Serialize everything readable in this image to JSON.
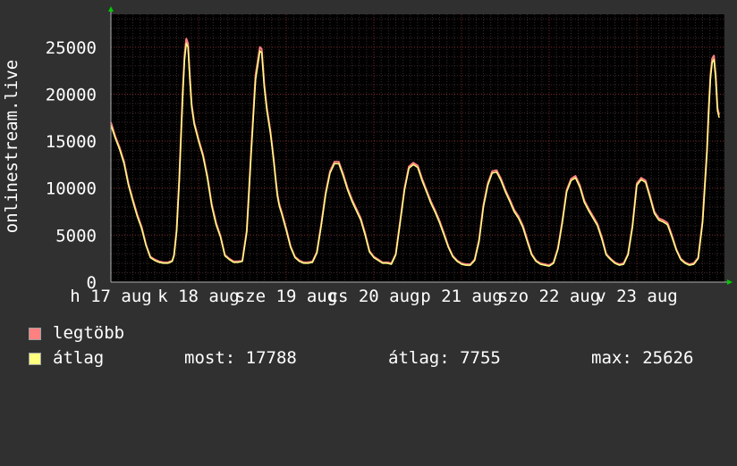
{
  "chart_data": {
    "type": "line",
    "ylabel": "onlinestream.live",
    "yticks": [
      0,
      5000,
      10000,
      15000,
      20000,
      25000
    ],
    "ylim": [
      0,
      28500
    ],
    "xlim": [
      0,
      7.0
    ],
    "grid": true,
    "xtick_labels": [
      {
        "pos": 0.0,
        "label": "h 17 aug"
      },
      {
        "pos": 1.0,
        "label": "k 18 aug"
      },
      {
        "pos": 2.0,
        "label": "sze 19 aug"
      },
      {
        "pos": 3.0,
        "label": "cs 20 aug"
      },
      {
        "pos": 4.0,
        "label": "p 21 aug"
      },
      {
        "pos": 5.0,
        "label": "szo 22 aug"
      },
      {
        "pos": 6.0,
        "label": "v 23 aug"
      }
    ],
    "series": [
      {
        "name": "legtöbb",
        "color": "#ff8080",
        "x": [
          0.0,
          0.05,
          0.1,
          0.15,
          0.2,
          0.25,
          0.3,
          0.35,
          0.4,
          0.45,
          0.5,
          0.55,
          0.6,
          0.65,
          0.7,
          0.72,
          0.75,
          0.78,
          0.8,
          0.82,
          0.84,
          0.86,
          0.88,
          0.9,
          0.92,
          0.95,
          1.0,
          1.05,
          1.1,
          1.15,
          1.2,
          1.25,
          1.3,
          1.35,
          1.4,
          1.45,
          1.5,
          1.55,
          1.6,
          1.65,
          1.7,
          1.72,
          1.75,
          1.78,
          1.8,
          1.82,
          1.84,
          1.86,
          1.88,
          1.9,
          1.92,
          1.95,
          2.0,
          2.05,
          2.1,
          2.15,
          2.2,
          2.25,
          2.3,
          2.35,
          2.4,
          2.45,
          2.5,
          2.55,
          2.6,
          2.65,
          2.7,
          2.75,
          2.8,
          2.85,
          2.9,
          2.95,
          3.0,
          3.05,
          3.1,
          3.15,
          3.2,
          3.25,
          3.3,
          3.35,
          3.4,
          3.45,
          3.5,
          3.55,
          3.6,
          3.65,
          3.7,
          3.75,
          3.8,
          3.85,
          3.9,
          3.95,
          4.0,
          4.05,
          4.1,
          4.15,
          4.2,
          4.25,
          4.3,
          4.35,
          4.4,
          4.45,
          4.5,
          4.55,
          4.6,
          4.65,
          4.7,
          4.75,
          4.8,
          4.85,
          4.9,
          4.95,
          5.0,
          5.05,
          5.1,
          5.15,
          5.2,
          5.25,
          5.3,
          5.35,
          5.4,
          5.45,
          5.5,
          5.55,
          5.6,
          5.65,
          5.7,
          5.75,
          5.8,
          5.85,
          5.9,
          5.95,
          6.0,
          6.05,
          6.1,
          6.15,
          6.2,
          6.25,
          6.3,
          6.35,
          6.4,
          6.45,
          6.5,
          6.55,
          6.6,
          6.65,
          6.7,
          6.75,
          6.8,
          6.82,
          6.84,
          6.86,
          6.88,
          6.9,
          6.92,
          6.94
        ],
        "values": [
          17000,
          15500,
          14300,
          12800,
          10500,
          8800,
          7200,
          5900,
          4000,
          2700,
          2400,
          2200,
          2100,
          2100,
          2300,
          2900,
          5600,
          11000,
          15800,
          20500,
          24100,
          25900,
          25400,
          22000,
          19000,
          17000,
          15200,
          13600,
          11300,
          8300,
          6300,
          4900,
          2900,
          2500,
          2200,
          2200,
          2300,
          5500,
          14000,
          22000,
          25000,
          24800,
          21000,
          18500,
          17300,
          16000,
          14500,
          12800,
          11000,
          9300,
          8300,
          7400,
          5700,
          3800,
          2700,
          2300,
          2100,
          2100,
          2200,
          3200,
          6200,
          9500,
          11800,
          12800,
          12800,
          11500,
          10000,
          8800,
          7800,
          6800,
          5200,
          3300,
          2700,
          2400,
          2100,
          2100,
          2000,
          3000,
          6500,
          10000,
          12300,
          12700,
          12400,
          11000,
          9800,
          8600,
          7600,
          6500,
          5200,
          3800,
          2800,
          2300,
          2000,
          1900,
          1900,
          2400,
          4500,
          8200,
          10500,
          11800,
          11900,
          11000,
          9800,
          8800,
          7700,
          7000,
          6000,
          4500,
          3000,
          2300,
          2000,
          1900,
          1800,
          2100,
          3600,
          6500,
          9800,
          11000,
          11300,
          10300,
          8700,
          7800,
          7000,
          6200,
          4800,
          3000,
          2500,
          2100,
          1900,
          2000,
          3000,
          6000,
          10500,
          11100,
          10800,
          9200,
          7500,
          6800,
          6600,
          6300,
          5000,
          3500,
          2500,
          2100,
          1900,
          2000,
          2600,
          6500,
          14000,
          18500,
          22000,
          23800,
          24100,
          22000,
          18500,
          17800
        ]
      },
      {
        "name": "átlag",
        "color": "#ffff80",
        "x": [
          0.0,
          0.05,
          0.1,
          0.15,
          0.2,
          0.25,
          0.3,
          0.35,
          0.4,
          0.45,
          0.5,
          0.55,
          0.6,
          0.65,
          0.7,
          0.72,
          0.75,
          0.78,
          0.8,
          0.82,
          0.84,
          0.86,
          0.88,
          0.9,
          0.92,
          0.95,
          1.0,
          1.05,
          1.1,
          1.15,
          1.2,
          1.25,
          1.3,
          1.35,
          1.4,
          1.45,
          1.5,
          1.55,
          1.6,
          1.65,
          1.7,
          1.72,
          1.75,
          1.78,
          1.8,
          1.82,
          1.84,
          1.86,
          1.88,
          1.9,
          1.92,
          1.95,
          2.0,
          2.05,
          2.1,
          2.15,
          2.2,
          2.25,
          2.3,
          2.35,
          2.4,
          2.45,
          2.5,
          2.55,
          2.6,
          2.65,
          2.7,
          2.75,
          2.8,
          2.85,
          2.9,
          2.95,
          3.0,
          3.05,
          3.1,
          3.15,
          3.2,
          3.25,
          3.3,
          3.35,
          3.4,
          3.45,
          3.5,
          3.55,
          3.6,
          3.65,
          3.7,
          3.75,
          3.8,
          3.85,
          3.9,
          3.95,
          4.0,
          4.05,
          4.1,
          4.15,
          4.2,
          4.25,
          4.3,
          4.35,
          4.4,
          4.45,
          4.5,
          4.55,
          4.6,
          4.65,
          4.7,
          4.75,
          4.8,
          4.85,
          4.9,
          4.95,
          5.0,
          5.05,
          5.1,
          5.15,
          5.2,
          5.25,
          5.3,
          5.35,
          5.4,
          5.45,
          5.5,
          5.55,
          5.6,
          5.65,
          5.7,
          5.75,
          5.8,
          5.85,
          5.9,
          5.95,
          6.0,
          6.05,
          6.1,
          6.15,
          6.2,
          6.25,
          6.3,
          6.35,
          6.4,
          6.45,
          6.5,
          6.55,
          6.6,
          6.65,
          6.7,
          6.75,
          6.8,
          6.82,
          6.84,
          6.86,
          6.88,
          6.9,
          6.92,
          6.94
        ],
        "values": [
          16700,
          15300,
          14100,
          12600,
          10300,
          8600,
          7000,
          5700,
          3900,
          2600,
          2300,
          2100,
          2000,
          2000,
          2200,
          2800,
          5400,
          10700,
          15400,
          20000,
          23600,
          25400,
          25000,
          21600,
          18700,
          16800,
          15000,
          13400,
          11100,
          8100,
          6100,
          4800,
          2800,
          2400,
          2100,
          2100,
          2200,
          5300,
          13600,
          21500,
          24600,
          24400,
          20700,
          18200,
          17000,
          15800,
          14300,
          12600,
          10800,
          9100,
          8100,
          7200,
          5500,
          3700,
          2600,
          2200,
          2000,
          2000,
          2100,
          3100,
          6000,
          9300,
          11600,
          12600,
          12600,
          11300,
          9800,
          8600,
          7600,
          6600,
          5000,
          3200,
          2600,
          2300,
          2000,
          2000,
          1900,
          2900,
          6300,
          9800,
          12100,
          12500,
          12200,
          10800,
          9600,
          8400,
          7400,
          6300,
          5000,
          3700,
          2700,
          2200,
          1900,
          1800,
          1800,
          2300,
          4300,
          8000,
          10300,
          11600,
          11700,
          10800,
          9600,
          8600,
          7500,
          6800,
          5800,
          4300,
          2900,
          2200,
          1900,
          1800,
          1700,
          2000,
          3500,
          6300,
          9600,
          10800,
          11100,
          10100,
          8500,
          7600,
          6800,
          6000,
          4600,
          2900,
          2400,
          2000,
          1800,
          1900,
          2900,
          5800,
          10300,
          10900,
          10600,
          9000,
          7300,
          6600,
          6400,
          6100,
          4800,
          3400,
          2400,
          2000,
          1800,
          1900,
          2500,
          6300,
          13700,
          18200,
          21600,
          23400,
          23700,
          21600,
          18200,
          17500
        ]
      }
    ]
  },
  "legend": {
    "items": [
      {
        "label": "legtöbb",
        "color": "#ff8080"
      },
      {
        "label": "átlag",
        "color": "#ffff80"
      }
    ],
    "stats": {
      "most": "most: 17788",
      "atlag": "átlag: 7755",
      "max": "max: 25626"
    }
  }
}
